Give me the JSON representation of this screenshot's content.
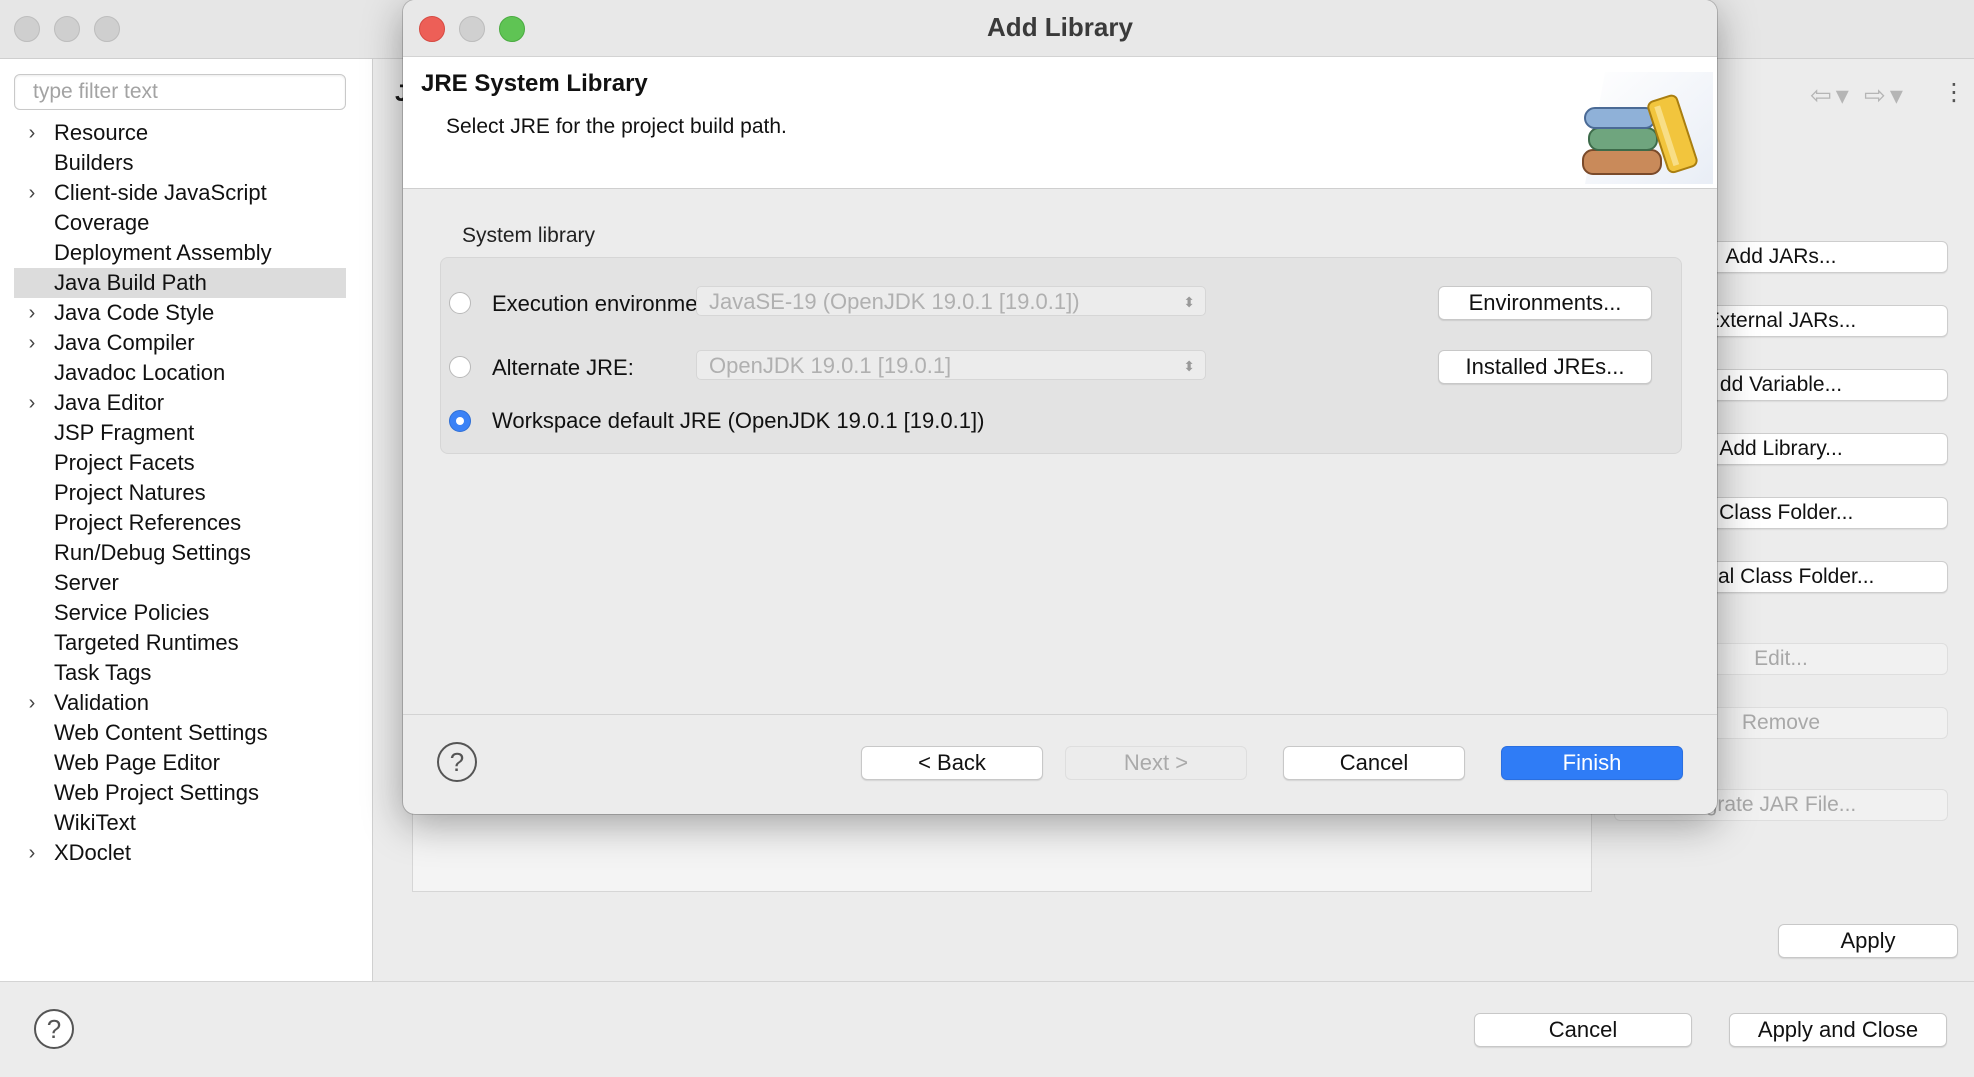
{
  "background_window": {
    "filter_placeholder": "type filter text",
    "tree_items": [
      {
        "label": "Resource",
        "expandable": true,
        "selected": false
      },
      {
        "label": "Builders",
        "expandable": false,
        "selected": false
      },
      {
        "label": "Client-side JavaScript",
        "expandable": true,
        "selected": false
      },
      {
        "label": "Coverage",
        "expandable": false,
        "selected": false
      },
      {
        "label": "Deployment Assembly",
        "expandable": false,
        "selected": false
      },
      {
        "label": "Java Build Path",
        "expandable": false,
        "selected": true
      },
      {
        "label": "Java Code Style",
        "expandable": true,
        "selected": false
      },
      {
        "label": "Java Compiler",
        "expandable": true,
        "selected": false
      },
      {
        "label": "Javadoc Location",
        "expandable": false,
        "selected": false
      },
      {
        "label": "Java Editor",
        "expandable": true,
        "selected": false
      },
      {
        "label": "JSP Fragment",
        "expandable": false,
        "selected": false
      },
      {
        "label": "Project Facets",
        "expandable": false,
        "selected": false
      },
      {
        "label": "Project Natures",
        "expandable": false,
        "selected": false
      },
      {
        "label": "Project References",
        "expandable": false,
        "selected": false
      },
      {
        "label": "Run/Debug Settings",
        "expandable": false,
        "selected": false
      },
      {
        "label": "Server",
        "expandable": false,
        "selected": false
      },
      {
        "label": "Service Policies",
        "expandable": false,
        "selected": false
      },
      {
        "label": "Targeted Runtimes",
        "expandable": false,
        "selected": false
      },
      {
        "label": "Task Tags",
        "expandable": false,
        "selected": false
      },
      {
        "label": "Validation",
        "expandable": true,
        "selected": false
      },
      {
        "label": "Web Content Settings",
        "expandable": false,
        "selected": false
      },
      {
        "label": "Web Page Editor",
        "expandable": false,
        "selected": false
      },
      {
        "label": "Web Project Settings",
        "expandable": false,
        "selected": false
      },
      {
        "label": "WikiText",
        "expandable": false,
        "selected": false
      },
      {
        "label": "XDoclet",
        "expandable": true,
        "selected": false
      }
    ],
    "content_title_fragment": "J",
    "right_buttons": [
      {
        "label": "Add JARs...",
        "enabled": true
      },
      {
        "label": "External JARs...",
        "enabled": true
      },
      {
        "label": "dd Variable...",
        "enabled": true
      },
      {
        "label": "Add Library...",
        "enabled": true
      },
      {
        "label": "l Class Folder...",
        "enabled": true
      },
      {
        "label": "ernal Class Folder...",
        "enabled": true
      },
      {
        "label": "Edit...",
        "enabled": false
      },
      {
        "label": "Remove",
        "enabled": false
      },
      {
        "label": "grate JAR File...",
        "enabled": false
      }
    ],
    "apply_label": "Apply",
    "cancel_label": "Cancel",
    "apply_close_label": "Apply and Close",
    "help_glyph": "?"
  },
  "dialog": {
    "title": "Add Library",
    "header_title": "JRE System Library",
    "header_subtitle": "Select JRE for the project build path.",
    "group_label": "System library",
    "options": {
      "exec_env_label": "Execution environment:",
      "exec_env_value": "JavaSE-19 (OpenJDK 19.0.1 [19.0.1])",
      "environments_button": "Environments...",
      "alt_jre_label": "Alternate JRE:",
      "alt_jre_value": "OpenJDK 19.0.1 [19.0.1]",
      "installed_jres_button": "Installed JREs...",
      "workspace_label": "Workspace default JRE (OpenJDK 19.0.1 [19.0.1])",
      "selected": "workspace"
    },
    "buttons": {
      "back": "< Back",
      "next": "Next >",
      "cancel": "Cancel",
      "finish": "Finish"
    },
    "help_glyph": "?",
    "colors": {
      "close": "#ed5f57",
      "minimize": "#d0d0d0",
      "zoom": "#5fc454",
      "primary": "#2f7cf6"
    }
  }
}
